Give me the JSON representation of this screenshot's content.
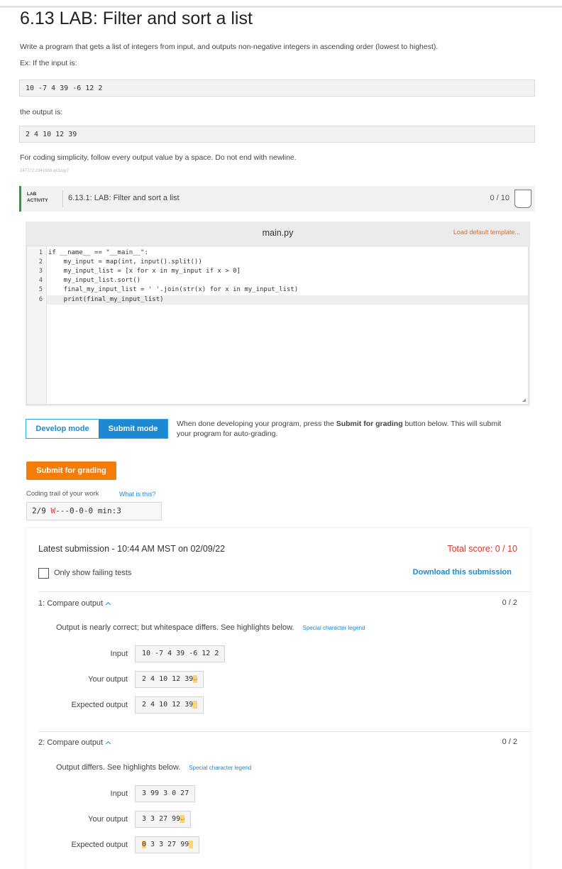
{
  "title": "6.13 LAB: Filter and sort a list",
  "description": "Write a program that gets a list of integers from input, and outputs non-negative integers in ascending order (lowest to highest).",
  "example_intro": "Ex: If the input is:",
  "example_input": "10 -7 4 39 -6 12 2",
  "output_intro": "the output is:",
  "example_output": "2 4 10 12 39",
  "note": "For coding simplicity, follow every output value by a space. Do not end with newline.",
  "tiny_id": "247772.2341668.qx3zqy7",
  "activity": {
    "tag_line1": "LAB",
    "tag_line2": "ACTIVITY",
    "title": "6.13.1: LAB: Filter and sort a list",
    "score": "0 / 10"
  },
  "editor": {
    "file_name": "main.py",
    "load_template": "Load default template...",
    "line_numbers": [
      "1",
      "2",
      "3",
      "4",
      "5",
      "6"
    ],
    "lines": [
      "if __name__ == \"__main__\":",
      "    my_input = map(int, input().split())",
      "    my_input_list = [x for x in my_input if x > 0]",
      "    my_input_list.sort()",
      "    final_my_input_list = ' '.join(str(x) for x in my_input_list)",
      "    print(final_my_input_list)"
    ]
  },
  "modes": {
    "develop": "Develop mode",
    "submit": "Submit mode",
    "hint_pre": "When done developing your program, press the ",
    "hint_bold": "Submit for grading",
    "hint_post": " button below. This will submit your program for auto-grading."
  },
  "submit_button": "Submit for grading",
  "trail": {
    "label": "Coding trail of your work",
    "what": "What is this?",
    "prefix": "2/9 ",
    "w": "W",
    "rest": "---0-0-0 min:3"
  },
  "results": {
    "latest": "Latest submission - 10:44 AM MST on 02/09/22",
    "total": "Total score: 0 / 10",
    "only_failing": "Only show failing tests",
    "download": "Download this submission",
    "tests": [
      {
        "title": "1: Compare output",
        "score": "0 / 2",
        "message": "Output is nearly correct; but whitespace differs. See highlights below.",
        "legend": "Special character legend",
        "input_label": "Input",
        "input": "10 -7 4 39 -6 12 2",
        "your_label": "Your output",
        "your_output": "2 4 10 12 39",
        "expected_label": "Expected output",
        "expected_output": "2 4 10 12 39"
      },
      {
        "title": "2: Compare output",
        "score": "0 / 2",
        "message": "Output differs. See highlights below.",
        "legend": "Special character legend",
        "input_label": "Input",
        "input": "3 99 3 0 27",
        "your_label": "Your output",
        "your_output": "3 3 27 99",
        "expected_label": "Expected output",
        "expected_first": "0",
        "expected_output": " 3 3 27 99"
      }
    ]
  }
}
